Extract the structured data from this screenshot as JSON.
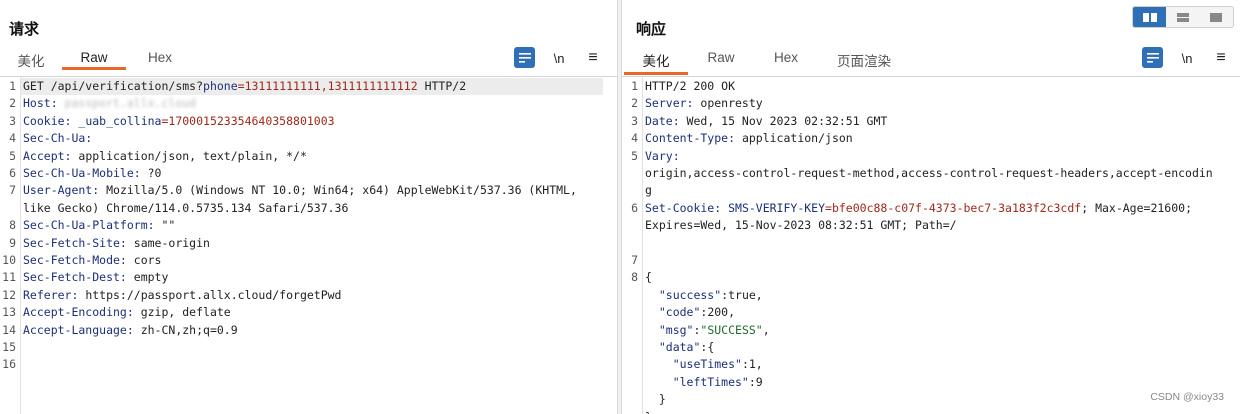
{
  "request": {
    "title": "请求",
    "tabs": [
      "美化",
      "Raw",
      "Hex"
    ],
    "active_tab": "Raw",
    "tools": {
      "newline_label": "\\n",
      "menu_label": "≡"
    },
    "lines": [
      {
        "n": "1",
        "parts": [
          [
            "GET /api/verification/sms?",
            "k"
          ],
          [
            "phone",
            "key"
          ],
          [
            "=13111111111,1311111111112",
            "val"
          ],
          [
            " HTTP/2",
            "k"
          ]
        ]
      },
      {
        "n": "2",
        "parts": [
          [
            "Host: ",
            "key"
          ],
          [
            "passport.allx.cloud",
            "blur"
          ]
        ]
      },
      {
        "n": "3",
        "parts": [
          [
            "Cookie: ",
            "key"
          ],
          [
            "_uab_collina",
            "key"
          ],
          [
            "=170001523354640358801003",
            "val"
          ]
        ]
      },
      {
        "n": "4",
        "parts": [
          [
            "Sec-Ch-Ua: ",
            "key"
          ]
        ]
      },
      {
        "n": "5",
        "parts": [
          [
            "Accept: ",
            "key"
          ],
          [
            "application/json, text/plain, */*",
            "k"
          ]
        ]
      },
      {
        "n": "6",
        "parts": [
          [
            "Sec-Ch-Ua-Mobile: ",
            "key"
          ],
          [
            "?0",
            "k"
          ]
        ]
      },
      {
        "n": "7",
        "parts": [
          [
            "User-Agent: ",
            "key"
          ],
          [
            "Mozilla/5.0 (Windows NT 10.0; Win64; x64) AppleWebKit/537.36 (KHTML,",
            "k"
          ]
        ]
      },
      {
        "n": "",
        "parts": [
          [
            "like Gecko) Chrome/114.0.5735.134 Safari/537.36",
            "k"
          ]
        ]
      },
      {
        "n": "8",
        "parts": [
          [
            "Sec-Ch-Ua-Platform: ",
            "key"
          ],
          [
            "\"\"",
            "k"
          ]
        ]
      },
      {
        "n": "9",
        "parts": [
          [
            "Sec-Fetch-Site: ",
            "key"
          ],
          [
            "same-origin",
            "k"
          ]
        ]
      },
      {
        "n": "10",
        "parts": [
          [
            "Sec-Fetch-Mode: ",
            "key"
          ],
          [
            "cors",
            "k"
          ]
        ]
      },
      {
        "n": "11",
        "parts": [
          [
            "Sec-Fetch-Dest: ",
            "key"
          ],
          [
            "empty",
            "k"
          ]
        ]
      },
      {
        "n": "12",
        "parts": [
          [
            "Referer: ",
            "key"
          ],
          [
            "https://passport.allx.cloud/forgetPwd",
            "k"
          ]
        ]
      },
      {
        "n": "13",
        "parts": [
          [
            "Accept-Encoding: ",
            "key"
          ],
          [
            "gzip, deflate",
            "k"
          ]
        ]
      },
      {
        "n": "14",
        "parts": [
          [
            "Accept-Language: ",
            "key"
          ],
          [
            "zh-CN,zh;q=0.9",
            "k"
          ]
        ]
      },
      {
        "n": "15",
        "parts": []
      },
      {
        "n": "16",
        "parts": []
      }
    ]
  },
  "response": {
    "title": "响应",
    "tabs": [
      "美化",
      "Raw",
      "Hex",
      "页面渲染"
    ],
    "active_tab": "美化",
    "tools": {
      "newline_label": "\\n",
      "menu_label": "≡"
    },
    "lines": [
      {
        "n": "1",
        "parts": [
          [
            "HTTP/2 200 OK",
            "k"
          ]
        ]
      },
      {
        "n": "2",
        "parts": [
          [
            "Server: ",
            "key"
          ],
          [
            "openresty",
            "k"
          ]
        ]
      },
      {
        "n": "3",
        "parts": [
          [
            "Date: ",
            "key"
          ],
          [
            "Wed, 15 Nov 2023 02:32:51 GMT",
            "k"
          ]
        ]
      },
      {
        "n": "4",
        "parts": [
          [
            "Content-Type: ",
            "key"
          ],
          [
            "application/json",
            "k"
          ]
        ]
      },
      {
        "n": "5",
        "parts": [
          [
            "Vary: ",
            "key"
          ]
        ]
      },
      {
        "n": "",
        "parts": [
          [
            "origin,access-control-request-method,access-control-request-headers,accept-encodin",
            "k"
          ]
        ]
      },
      {
        "n": "",
        "parts": [
          [
            "g",
            "k"
          ]
        ]
      },
      {
        "n": "6",
        "parts": [
          [
            "Set-Cookie: ",
            "key"
          ],
          [
            "SMS-VERIFY-KEY",
            "key"
          ],
          [
            "=bfe00c88-c07f-4373-bec7-3a183f2c3cdf",
            "val"
          ],
          [
            "; Max-Age=21600;",
            "k"
          ]
        ]
      },
      {
        "n": "",
        "parts": [
          [
            "Expires=Wed, 15-Nov-2023 08:32:51 GMT; Path=/",
            "k"
          ]
        ]
      },
      {
        "n": "",
        "parts": []
      },
      {
        "n": "7",
        "parts": []
      },
      {
        "n": "8",
        "parts": [
          [
            "{",
            "k"
          ]
        ]
      },
      {
        "n": "",
        "parts": [
          [
            "  \"success\"",
            "key"
          ],
          [
            ":true,",
            "k"
          ]
        ]
      },
      {
        "n": "",
        "parts": [
          [
            "  \"code\"",
            "key"
          ],
          [
            ":200,",
            "k"
          ]
        ]
      },
      {
        "n": "",
        "parts": [
          [
            "  \"msg\"",
            "key"
          ],
          [
            ":",
            "k"
          ],
          [
            "\"SUCCESS\"",
            "str"
          ],
          [
            ",",
            "k"
          ]
        ]
      },
      {
        "n": "",
        "parts": [
          [
            "  \"data\"",
            "key"
          ],
          [
            ":{",
            "k"
          ]
        ]
      },
      {
        "n": "",
        "parts": [
          [
            "    \"useTimes\"",
            "key"
          ],
          [
            ":1,",
            "k"
          ]
        ]
      },
      {
        "n": "",
        "parts": [
          [
            "    \"leftTimes\"",
            "key"
          ],
          [
            ":9",
            "k"
          ]
        ]
      },
      {
        "n": "",
        "parts": [
          [
            "  }",
            "k"
          ]
        ]
      },
      {
        "n": "",
        "parts": [
          [
            "}",
            "k"
          ]
        ]
      }
    ]
  },
  "view_toggle": [
    "split-horizontal-icon",
    "split-vertical-icon",
    "single-pane-icon"
  ],
  "watermark": "CSDN @xioy33",
  "colors": {
    "accent": "#e8672b",
    "button_blue": "#2f6fb6",
    "header_key": "#1c2f7a",
    "value_red": "#a0281a",
    "json_string": "#1f6a2e"
  }
}
